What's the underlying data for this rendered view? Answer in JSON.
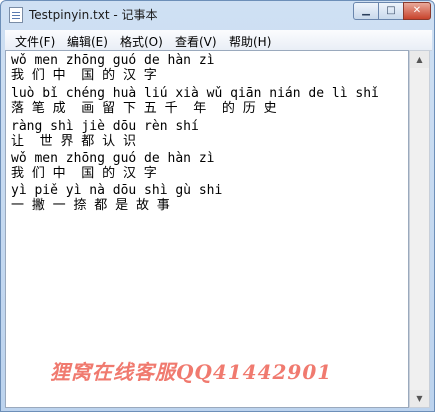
{
  "window": {
    "title": "Testpinyin.txt - 记事本",
    "min_glyph": "▁",
    "max_glyph": "□",
    "close_glyph": "✕"
  },
  "menu": [
    {
      "label": "文件(F)"
    },
    {
      "label": "编辑(E)"
    },
    {
      "label": "格式(O)"
    },
    {
      "label": "查看(V)"
    },
    {
      "label": "帮助(H)"
    }
  ],
  "editor": {
    "lines": [
      "wǒ men zhōng guó de hàn zì",
      "我 们 中  国 的 汉 字",
      "luò bǐ chéng huà liú xià wǔ qiān nián de lì shǐ",
      "落 笔 成  画 留 下 五 千  年  的 历 史",
      "ràng shì jiè dōu rèn shí",
      "让  世 界 都 认 识",
      "wǒ men zhōng guó de hàn zì",
      "我 们 中  国 的 汉 字",
      "yì piě yì nà dōu shì gù shi",
      "一 撇 一 捺 都 是 故 事"
    ]
  },
  "scrollbar": {
    "up_glyph": "▲",
    "down_glyph": "▼"
  },
  "watermark": {
    "text": "狸窝在线客服QQ41442901"
  }
}
